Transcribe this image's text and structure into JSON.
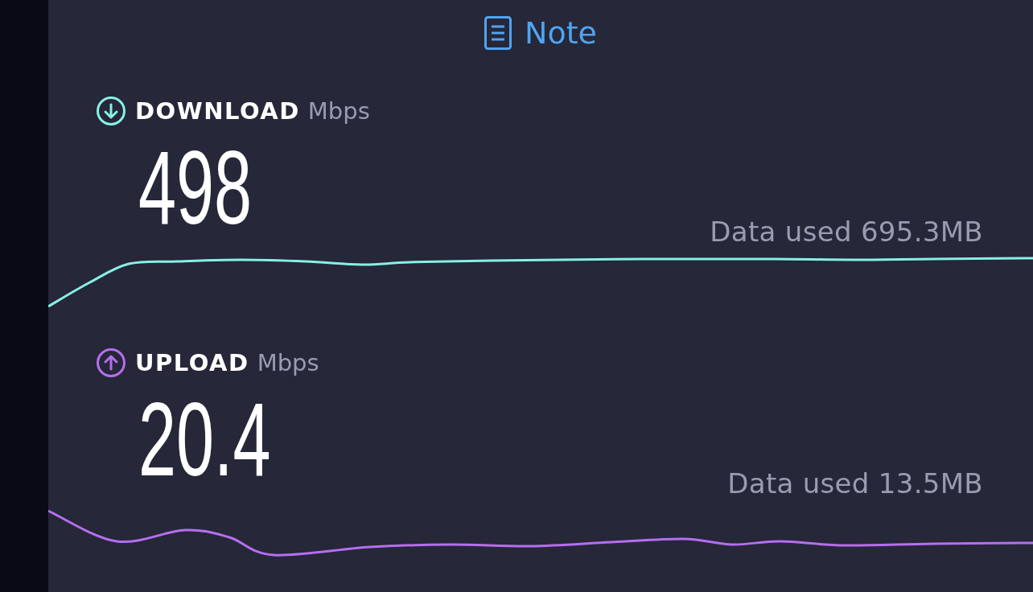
{
  "note_link": {
    "label": "Note"
  },
  "metrics": [
    {
      "kind": "download",
      "label": "DOWNLOAD",
      "unit": "Mbps",
      "value": "498",
      "data_used": "Data used 695.3MB",
      "color": "#86f1e4"
    },
    {
      "kind": "upload",
      "label": "UPLOAD",
      "unit": "Mbps",
      "value": "20.4",
      "data_used": "Data used 13.5MB",
      "color": "#b56ef0"
    }
  ]
}
